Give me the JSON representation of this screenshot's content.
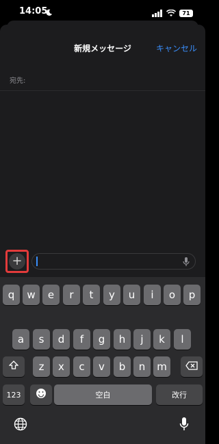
{
  "status_bar": {
    "time": "14:05",
    "battery": "71"
  },
  "nav": {
    "title": "新規メッセージ",
    "cancel": "キャンセル"
  },
  "to_field": {
    "label": "宛先:"
  },
  "compose": {
    "plus": "+"
  },
  "keyboard": {
    "row1": [
      "q",
      "w",
      "e",
      "r",
      "t",
      "y",
      "u",
      "i",
      "o",
      "p"
    ],
    "row2": [
      "a",
      "s",
      "d",
      "f",
      "g",
      "h",
      "j",
      "k",
      "l"
    ],
    "row3": [
      "z",
      "x",
      "c",
      "v",
      "b",
      "n",
      "m"
    ],
    "num_key": "123",
    "space": "空白",
    "return": "改行"
  },
  "icons": [
    "moon-icon",
    "signal-icon",
    "wifi-icon",
    "battery-icon",
    "plus-icon",
    "microphone-icon",
    "shift-icon",
    "delete-icon",
    "emoji-icon",
    "globe-icon",
    "dictation-icon"
  ]
}
